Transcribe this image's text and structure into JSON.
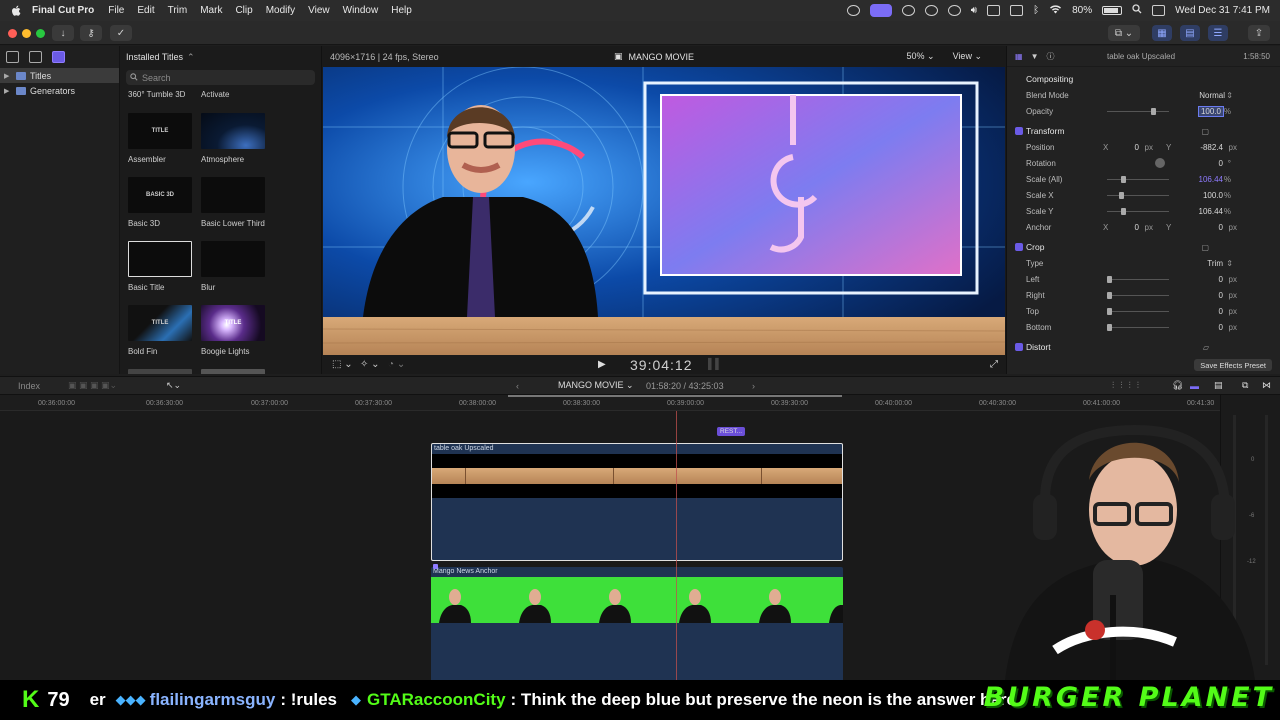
{
  "menubar": {
    "app_name": "Final Cut Pro",
    "items": [
      "File",
      "Edit",
      "Trim",
      "Mark",
      "Clip",
      "Modify",
      "View",
      "Window",
      "Help"
    ],
    "battery": "80%",
    "datetime": "Wed Dec 31  7:41 PM"
  },
  "library": {
    "items": [
      {
        "label": "Titles",
        "selected": true
      },
      {
        "label": "Generators",
        "selected": false
      }
    ]
  },
  "browser": {
    "header": "Installed Titles",
    "search_placeholder": "Search",
    "top_row": [
      "360° Tumble 3D",
      "Activate"
    ],
    "tiles": [
      {
        "label": "Assembler",
        "thumb_text": "TITLE"
      },
      {
        "label": "Atmosphere",
        "thumb_text": ""
      },
      {
        "label": "Basic 3D",
        "thumb_text": "BASIC 3D"
      },
      {
        "label": "Basic Lower Third",
        "thumb_text": ""
      },
      {
        "label": "Basic Title",
        "thumb_text": "",
        "selected": true
      },
      {
        "label": "Blur",
        "thumb_text": ""
      },
      {
        "label": "Bold Fin",
        "thumb_text": "TITLE"
      },
      {
        "label": "Boogie Lights",
        "thumb_text": "TITLE"
      }
    ]
  },
  "viewer": {
    "format": "4096×1716 | 24 fps, Stereo",
    "project": "MANGO MOVIE",
    "zoom": "50%",
    "view_menu": "View",
    "timecode": "39:04:12"
  },
  "inspector": {
    "clip_name": "table oak Upscaled",
    "duration": "1:58:50",
    "compositing": "Compositing",
    "blend_mode_label": "Blend Mode",
    "blend_mode_value": "Normal",
    "opacity_label": "Opacity",
    "opacity_value": "100.0",
    "opacity_fill": 0.78,
    "transform": "Transform",
    "position_label": "Position",
    "position_x": "0",
    "position_y": "-882.4",
    "rotation_label": "Rotation",
    "rotation_value": "0",
    "scale_all_label": "Scale (All)",
    "scale_all_value": "106.44",
    "scale_x_label": "Scale X",
    "scale_x_value": "100.0",
    "scale_y_label": "Scale Y",
    "scale_y_value": "106.44",
    "anchor_label": "Anchor",
    "anchor_x": "0",
    "anchor_y": "0",
    "crop": "Crop",
    "type_label": "Type",
    "type_value": "Trim",
    "left_label": "Left",
    "left_value": "0",
    "right_label": "Right",
    "right_value": "0",
    "top_label": "Top",
    "top_value": "0",
    "bottom_label": "Bottom",
    "bottom_value": "0",
    "distort": "Distort",
    "save_preset": "Save Effects Preset",
    "px": "px",
    "pct": "%",
    "deg": "°",
    "x_label": "X",
    "y_label": "Y"
  },
  "timeline": {
    "index": "Index",
    "project": "MANGO MOVIE",
    "timecode_range": "01:58:20 / 43:25:03",
    "ruler_ticks": [
      "00:36:00:00",
      "00:36:30:00",
      "00:37:00:00",
      "00:37:30:00",
      "00:38:00:00",
      "00:38:30:00",
      "00:39:00:00",
      "00:39:30:00",
      "00:40:00:00",
      "00:40:30:00",
      "00:41:00:00",
      "00:41:30"
    ],
    "marker": "REST...",
    "clip1": "table oak Upscaled",
    "clip2": "Mango News Anchor",
    "meter_labels": [
      "0",
      "-6",
      "-12"
    ]
  },
  "ticker": {
    "viewer_count": "79",
    "message_prefix": "er",
    "user1": "flailingarmsguy",
    "msg1": ": !rules",
    "user2": "GTARaccoonCity",
    "msg2": ": Think the deep blue but preserve the neon is the answer here",
    "brand": "BURGER PLANET"
  },
  "colors": {
    "accent": "#6b5be6",
    "kick_green": "#53fc18",
    "clip_blue": "#1f3352",
    "green_screen": "#3ee03a"
  }
}
